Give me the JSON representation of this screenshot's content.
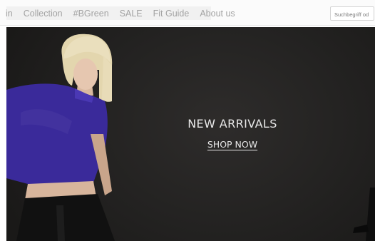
{
  "nav": {
    "items": [
      {
        "label": "in"
      },
      {
        "label": "Collection"
      },
      {
        "label": "#BGreen"
      },
      {
        "label": "SALE"
      },
      {
        "label": "Fit Guide"
      },
      {
        "label": "About us"
      }
    ]
  },
  "search": {
    "placeholder": "Suchbegriff od",
    "value": ""
  },
  "hero": {
    "headline": "NEW ARRIVALS",
    "cta_label": "SHOP NOW",
    "colors": {
      "background": "#232221",
      "top_color": "#3a2a9a",
      "pants_color": "#111111",
      "text": "#e9e9e9"
    }
  }
}
